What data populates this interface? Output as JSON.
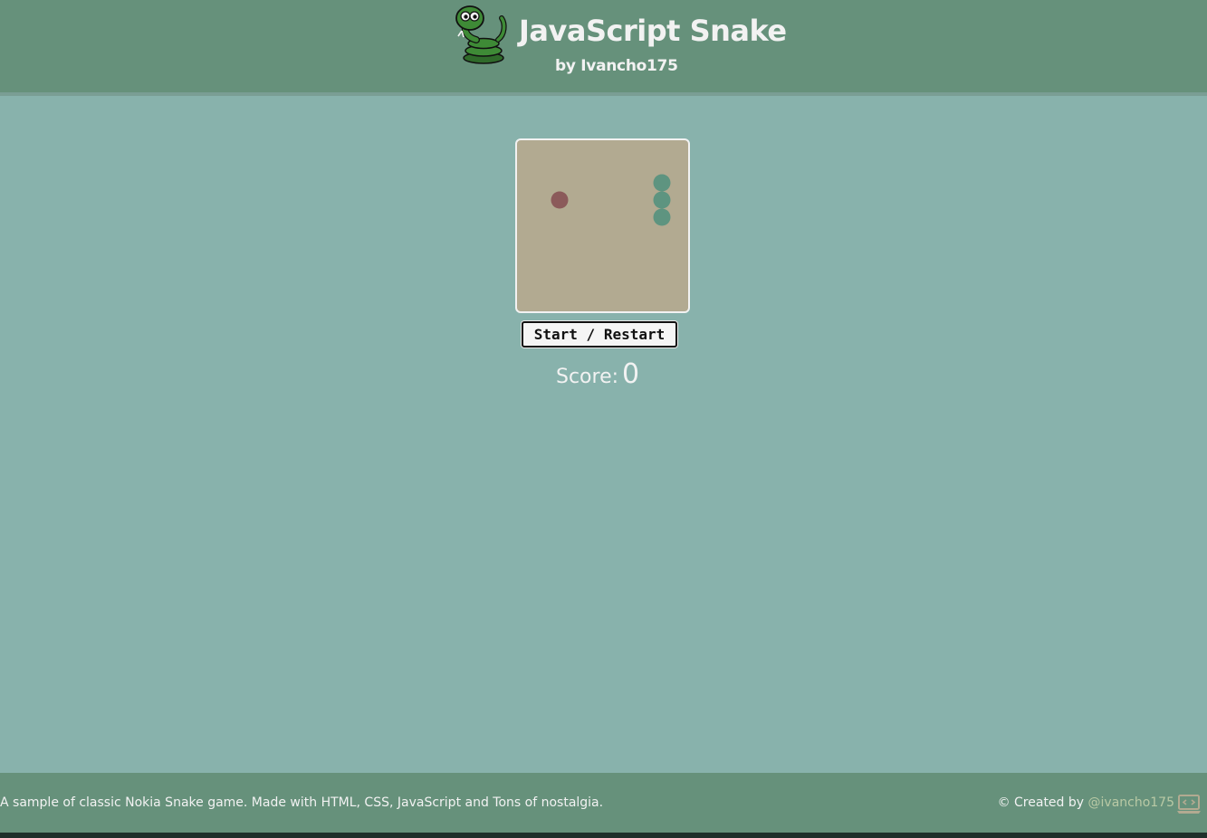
{
  "header": {
    "title": "JavaScript Snake",
    "subtitle": "by Ivancho175",
    "logo_icon": "snake-logo-icon"
  },
  "game": {
    "start_button_label": "Start / Restart",
    "score_label": "Score:",
    "score_value": "0",
    "board_color": "#b2aa91",
    "snake_color": "#5e9480",
    "food_color": "#8b5a5a"
  },
  "footer": {
    "description": "A sample of classic Nokia Snake game. Made with HTML, CSS, JavaScript and Tons of nostalgia.",
    "credit_prefix": "© Created by ",
    "credit_link": "@ivancho175",
    "laptop_icon": "laptop-code-icon"
  }
}
